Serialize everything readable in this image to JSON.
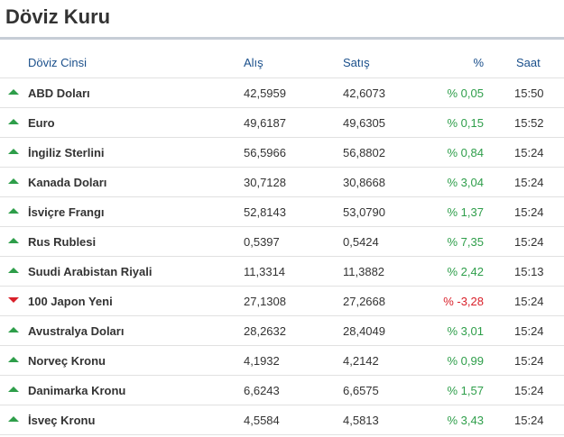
{
  "widget": {
    "title": "Döviz Kuru"
  },
  "colors": {
    "up": "#2e9e4a",
    "down": "#d9202a",
    "header_text": "#1a4f8b",
    "title_rule": "#c6cdd6"
  },
  "table": {
    "headers": {
      "name": "Döviz Cinsi",
      "buy": "Alış",
      "sell": "Satış",
      "pct": "%",
      "time": "Saat"
    },
    "rows": [
      {
        "direction": "up",
        "direction_icon": "triangle-up-icon",
        "name": "ABD Doları",
        "buy": "42,5959",
        "sell": "42,6073",
        "pct": "% 0,05",
        "time": "15:50"
      },
      {
        "direction": "up",
        "direction_icon": "triangle-up-icon",
        "name": "Euro",
        "buy": "49,6187",
        "sell": "49,6305",
        "pct": "% 0,15",
        "time": "15:52"
      },
      {
        "direction": "up",
        "direction_icon": "triangle-up-icon",
        "name": "İngiliz Sterlini",
        "buy": "56,5966",
        "sell": "56,8802",
        "pct": "% 0,84",
        "time": "15:24"
      },
      {
        "direction": "up",
        "direction_icon": "triangle-up-icon",
        "name": "Kanada Doları",
        "buy": "30,7128",
        "sell": "30,8668",
        "pct": "% 3,04",
        "time": "15:24"
      },
      {
        "direction": "up",
        "direction_icon": "triangle-up-icon",
        "name": "İsviçre Frangı",
        "buy": "52,8143",
        "sell": "53,0790",
        "pct": "% 1,37",
        "time": "15:24"
      },
      {
        "direction": "up",
        "direction_icon": "triangle-up-icon",
        "name": "Rus Rublesi",
        "buy": "0,5397",
        "sell": "0,5424",
        "pct": "% 7,35",
        "time": "15:24"
      },
      {
        "direction": "up",
        "direction_icon": "triangle-up-icon",
        "name": "Suudi Arabistan Riyali",
        "buy": "11,3314",
        "sell": "11,3882",
        "pct": "% 2,42",
        "time": "15:13"
      },
      {
        "direction": "down",
        "direction_icon": "triangle-down-icon",
        "name": "100 Japon Yeni",
        "buy": "27,1308",
        "sell": "27,2668",
        "pct": "% -3,28",
        "time": "15:24"
      },
      {
        "direction": "up",
        "direction_icon": "triangle-up-icon",
        "name": "Avustralya Doları",
        "buy": "28,2632",
        "sell": "28,4049",
        "pct": "% 3,01",
        "time": "15:24"
      },
      {
        "direction": "up",
        "direction_icon": "triangle-up-icon",
        "name": "Norveç Kronu",
        "buy": "4,1932",
        "sell": "4,2142",
        "pct": "% 0,99",
        "time": "15:24"
      },
      {
        "direction": "up",
        "direction_icon": "triangle-up-icon",
        "name": "Danimarka Kronu",
        "buy": "6,6243",
        "sell": "6,6575",
        "pct": "% 1,57",
        "time": "15:24"
      },
      {
        "direction": "up",
        "direction_icon": "triangle-up-icon",
        "name": "İsveç Kronu",
        "buy": "4,5584",
        "sell": "4,5813",
        "pct": "% 3,43",
        "time": "15:24"
      }
    ]
  }
}
